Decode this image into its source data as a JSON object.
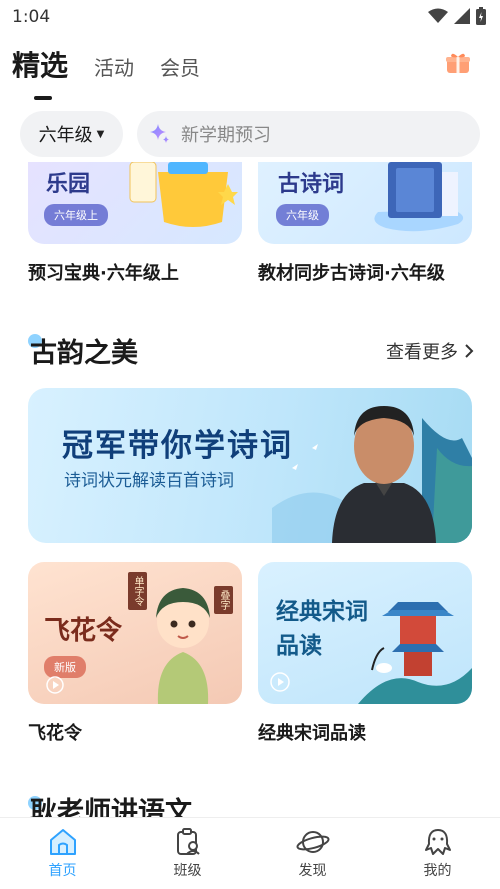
{
  "status_bar": {
    "time": "1:04"
  },
  "top_tabs": {
    "selected": "精选",
    "activity": "活动",
    "member": "会员"
  },
  "filter": {
    "grade": "六年级",
    "search_placeholder": "新学期预习"
  },
  "top_cards": [
    {
      "art_title": "乐园",
      "tag": "六年级上",
      "caption": "预习宝典·六年级上"
    },
    {
      "art_title": "古诗词",
      "tag": "六年级",
      "caption": "教材同步古诗词·六年级"
    }
  ],
  "section1": {
    "title": "古韵之美",
    "more": "查看更多"
  },
  "banner": {
    "title": "冠军带你学诗词",
    "subtitle": "诗词状元解读百首诗词"
  },
  "small_cards": [
    {
      "art_title": "飞花令",
      "tag": "新版",
      "scroll1": "单字令",
      "scroll2": "叠字",
      "caption": "飞花令"
    },
    {
      "art_title_line1": "经典宋词",
      "art_title_line2": "品读",
      "caption": "经典宋词品读"
    }
  ],
  "section2": {
    "title": "耿老师讲语文"
  },
  "bottom_nav": [
    {
      "label": "首页",
      "icon": "home-icon"
    },
    {
      "label": "班级",
      "icon": "class-icon"
    },
    {
      "label": "发现",
      "icon": "planet-icon"
    },
    {
      "label": "我的",
      "icon": "octopus-icon"
    }
  ],
  "colors": {
    "accent": "#2ea2ff",
    "section_dot": "#8fd3ff"
  }
}
